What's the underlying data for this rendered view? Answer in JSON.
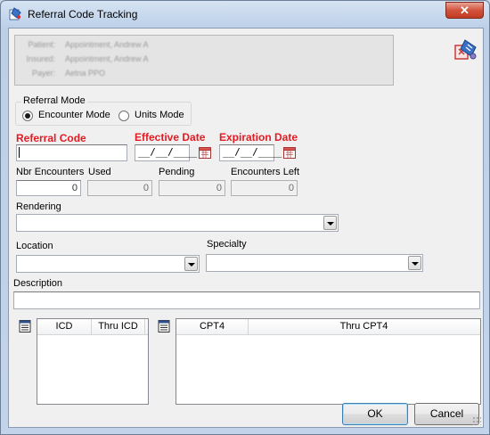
{
  "window": {
    "title": "Referral Code Tracking",
    "close_glyph": "✕"
  },
  "patient_info": {
    "rows": [
      {
        "key": "Patient:",
        "value": "Appointment, Andrew A"
      },
      {
        "key": "Insured:",
        "value": "Appointment, Andrew A"
      },
      {
        "key": "Payer:",
        "value": "Aetna PPO"
      }
    ]
  },
  "referral_mode": {
    "title": "Referral Mode",
    "options": [
      {
        "label": "Encounter Mode",
        "selected": true
      },
      {
        "label": "Units Mode",
        "selected": false
      }
    ]
  },
  "fields": {
    "referral_code": {
      "label": "Referral Code",
      "value": ""
    },
    "effective_date": {
      "label": "Effective Date",
      "value": "__/__/____"
    },
    "expiration_date": {
      "label": "Expiration Date",
      "value": "__/__/____"
    },
    "nbr_encounters": {
      "label": "Nbr Encounters",
      "value": "0"
    },
    "used": {
      "label": "Used",
      "value": "0"
    },
    "pending": {
      "label": "Pending",
      "value": "0"
    },
    "encounters_left": {
      "label": "Encounters Left",
      "value": "0"
    },
    "rendering": {
      "label": "Rendering",
      "value": ""
    },
    "location": {
      "label": "Location",
      "value": ""
    },
    "specialty": {
      "label": "Specialty",
      "value": ""
    },
    "description": {
      "label": "Description",
      "value": ""
    }
  },
  "icd_list": {
    "columns": [
      "ICD",
      "Thru ICD"
    ]
  },
  "cpt_list": {
    "columns": [
      "CPT4",
      "Thru CPT4"
    ]
  },
  "buttons": {
    "ok": "OK",
    "cancel": "Cancel"
  },
  "icons": {
    "title": "referral-document-icon",
    "corner": "referral-logo-icon",
    "calendar": "calendar-icon",
    "list_edit": "list-edit-icon"
  },
  "colors": {
    "required_label": "#e31b23",
    "close_button": "#c23a22"
  }
}
